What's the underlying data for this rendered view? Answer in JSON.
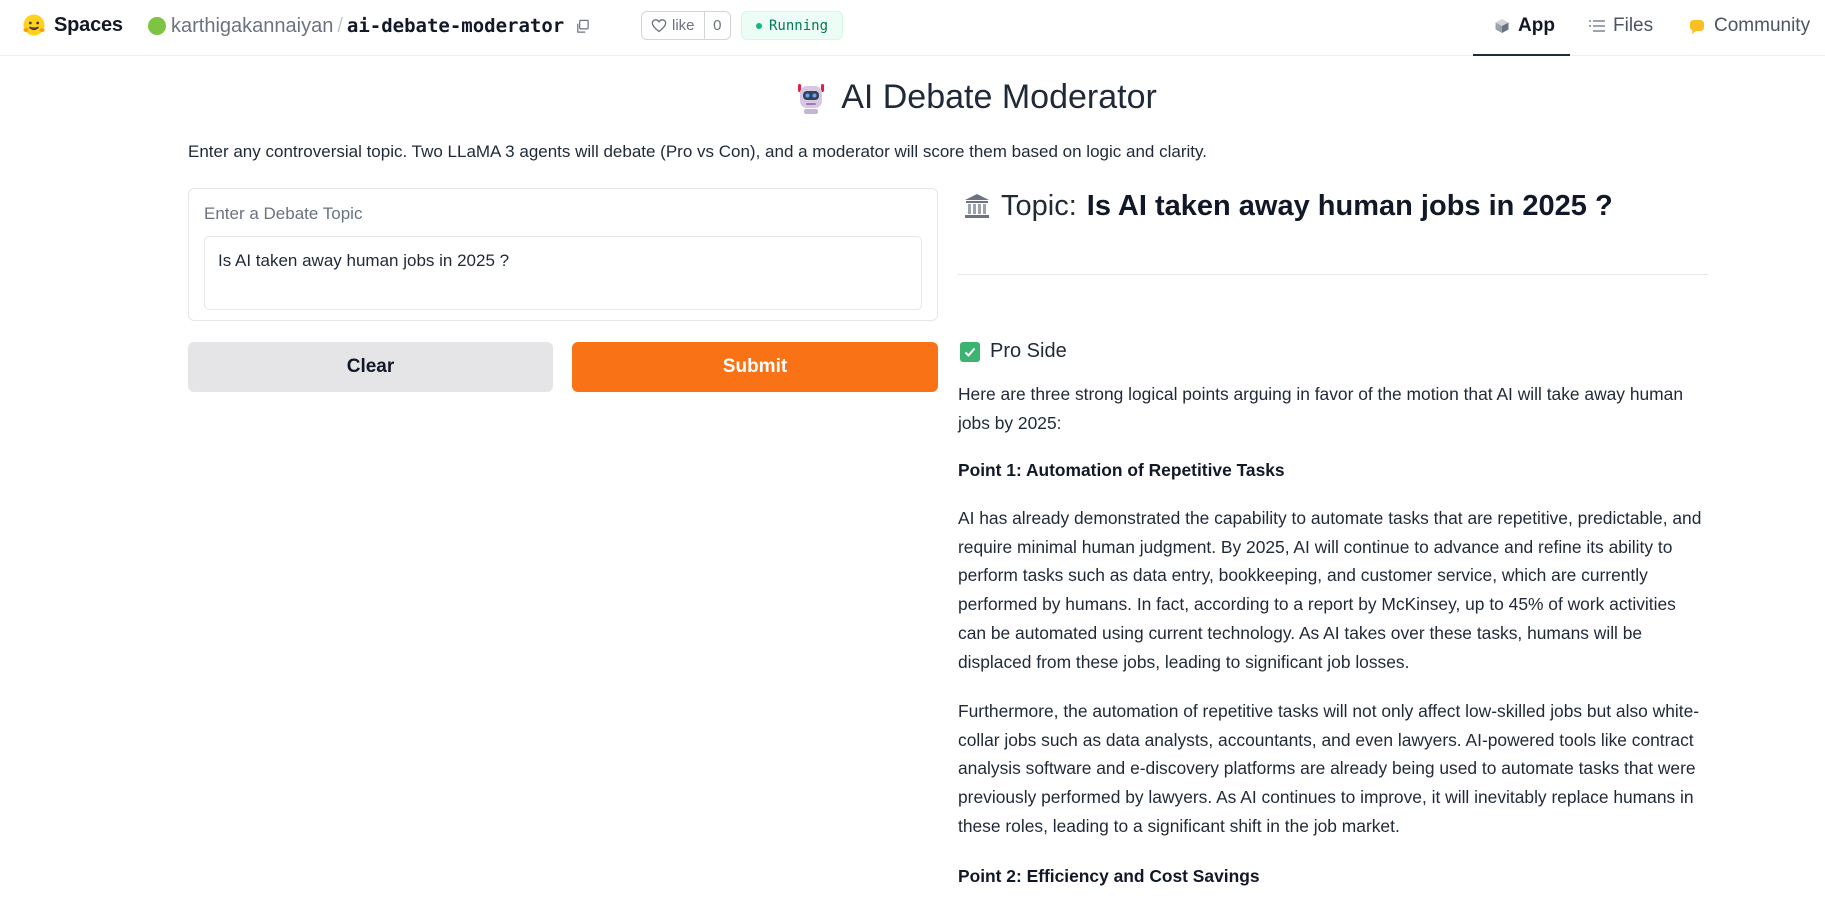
{
  "header": {
    "brand": "Spaces",
    "owner": "karthigakannaiyan",
    "separator": "/",
    "repo": "ai-debate-moderator",
    "like_label": "like",
    "like_count": "0",
    "status": "Running",
    "tabs": [
      {
        "label": "App",
        "icon": "cube-icon"
      },
      {
        "label": "Files",
        "icon": "files-icon"
      },
      {
        "label": "Community",
        "icon": "community-icon"
      }
    ],
    "active_tab": "App"
  },
  "app": {
    "title": "AI Debate Moderator",
    "title_icon": "robot-icon",
    "description": "Enter any controversial topic. Two LLaMA 3 agents will debate (Pro vs Con), and a moderator will score them based on logic and clarity.",
    "input_label": "Enter a Debate Topic",
    "input_value": "Is AI taken away human jobs in 2025 ?",
    "clear_label": "Clear",
    "submit_label": "Submit"
  },
  "output": {
    "topic_prefix": "Topic:",
    "topic_value": "Is AI taken away human jobs in 2025 ?",
    "pro_heading": "Pro Side",
    "intro": "Here are three strong logical points arguing in favor of the motion that AI will take away human jobs by 2025:",
    "point1_title": "Point 1: Automation of Repetitive Tasks",
    "para1": "AI has already demonstrated the capability to automate tasks that are repetitive, predictable, and require minimal human judgment. By 2025, AI will continue to advance and refine its ability to perform tasks such as data entry, bookkeeping, and customer service, which are currently performed by humans. In fact, according to a report by McKinsey, up to 45% of work activities can be automated using current technology. As AI takes over these tasks, humans will be displaced from these jobs, leading to significant job losses.",
    "para2": "Furthermore, the automation of repetitive tasks will not only affect low-skilled jobs but also white-collar jobs such as data analysts, accountants, and even lawyers. AI-powered tools like contract analysis software and e-discovery platforms are already being used to automate tasks that were previously performed by lawyers. As AI continues to improve, it will inevitably replace humans in these roles, leading to a significant shift in the job market.",
    "point2_title": "Point 2: Efficiency and Cost Savings"
  },
  "colors": {
    "accent": "#f97316",
    "running_text": "#047857",
    "running_bg": "#ecfdf5",
    "owner_dot": "#7cc441"
  }
}
